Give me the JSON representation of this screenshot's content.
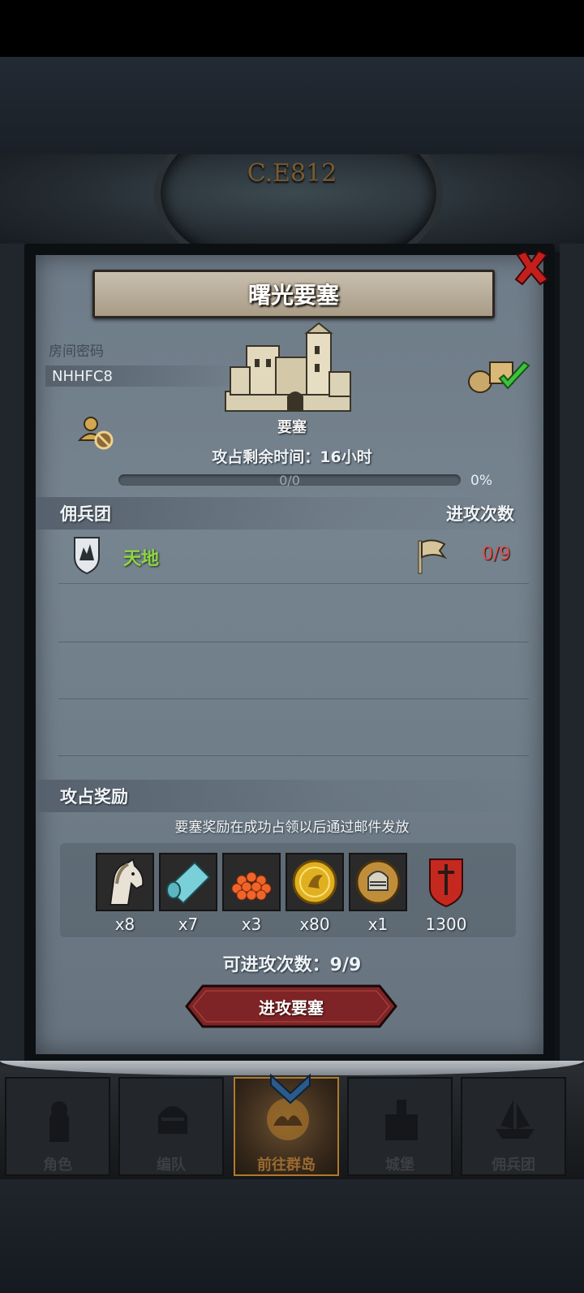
{
  "header": {
    "year_text": "C.E812"
  },
  "dialog": {
    "title": "曙光要塞",
    "room_label": "房间密码",
    "room_code": "NHHFC8",
    "fortress_label": "要塞",
    "time_remaining": "攻占剩余时间：16小时",
    "progress": {
      "text": "0/0",
      "percent_text": "0%",
      "fraction": 0
    },
    "mercenary_section": {
      "title": "佣兵团",
      "right_title": "进攻次数"
    },
    "mercenaries": [
      {
        "name": "天地",
        "attacks": "0/9"
      }
    ],
    "rewards_section": {
      "title": "攻占奖励",
      "note": "要塞奖励在成功占领以后通过邮件发放"
    },
    "rewards": [
      {
        "icon": "horse-icon",
        "count": "x8"
      },
      {
        "icon": "cloth-icon",
        "count": "x7"
      },
      {
        "icon": "roe-icon",
        "count": "x3"
      },
      {
        "icon": "gold-coin-icon",
        "count": "x80"
      },
      {
        "icon": "knight-helmet-icon",
        "count": "x1"
      },
      {
        "icon": "sword-banner-icon",
        "count": "1300"
      }
    ],
    "attack_count": "可进攻次数：9/9",
    "attack_button": "进攻要塞"
  },
  "nav": {
    "items": [
      {
        "label": "角色",
        "icon": "knight-icon"
      },
      {
        "label": "编队",
        "icon": "helmet-icon"
      },
      {
        "label": "前往群岛",
        "icon": "island-icon",
        "active": true
      },
      {
        "label": "城堡",
        "icon": "castle-icon"
      },
      {
        "label": "佣兵团",
        "icon": "ship-icon"
      }
    ]
  },
  "colors": {
    "accent_green": "#8fd34a",
    "accent_red": "#d25552",
    "button_red": "#7e2426",
    "nav_active": "#b07a2a"
  }
}
